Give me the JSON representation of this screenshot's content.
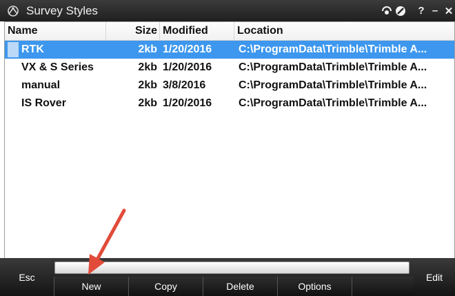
{
  "window": {
    "title": "Survey Styles",
    "controls": {
      "help": "?",
      "minimize": "–",
      "close": "✕"
    }
  },
  "columns": {
    "name": "Name",
    "size": "Size",
    "modified": "Modified",
    "location": "Location"
  },
  "rows": [
    {
      "name": "RTK",
      "size": "2kb",
      "modified": "1/20/2016",
      "location": "C:\\ProgramData\\Trimble\\Trimble A...",
      "selected": true
    },
    {
      "name": "VX & S Series",
      "size": "2kb",
      "modified": "1/20/2016",
      "location": "C:\\ProgramData\\Trimble\\Trimble A..."
    },
    {
      "name": "manual",
      "size": "2kb",
      "modified": "3/8/2016",
      "location": "C:\\ProgramData\\Trimble\\Trimble A..."
    },
    {
      "name": "IS Rover",
      "size": "2kb",
      "modified": "1/20/2016",
      "location": "C:\\ProgramData\\Trimble\\Trimble A..."
    }
  ],
  "softkeys": {
    "esc": "Esc",
    "new": "New",
    "copy": "Copy",
    "delete": "Delete",
    "options": "Options",
    "edit": "Edit"
  },
  "icons": {
    "app": "survey-app-icon",
    "status1": "gps-status-icon",
    "status2": "no-entry-icon"
  },
  "colors": {
    "selection": "#3d97ee",
    "annotation_arrow": "#e24b3a",
    "titlebar": "#2a2a2a"
  }
}
